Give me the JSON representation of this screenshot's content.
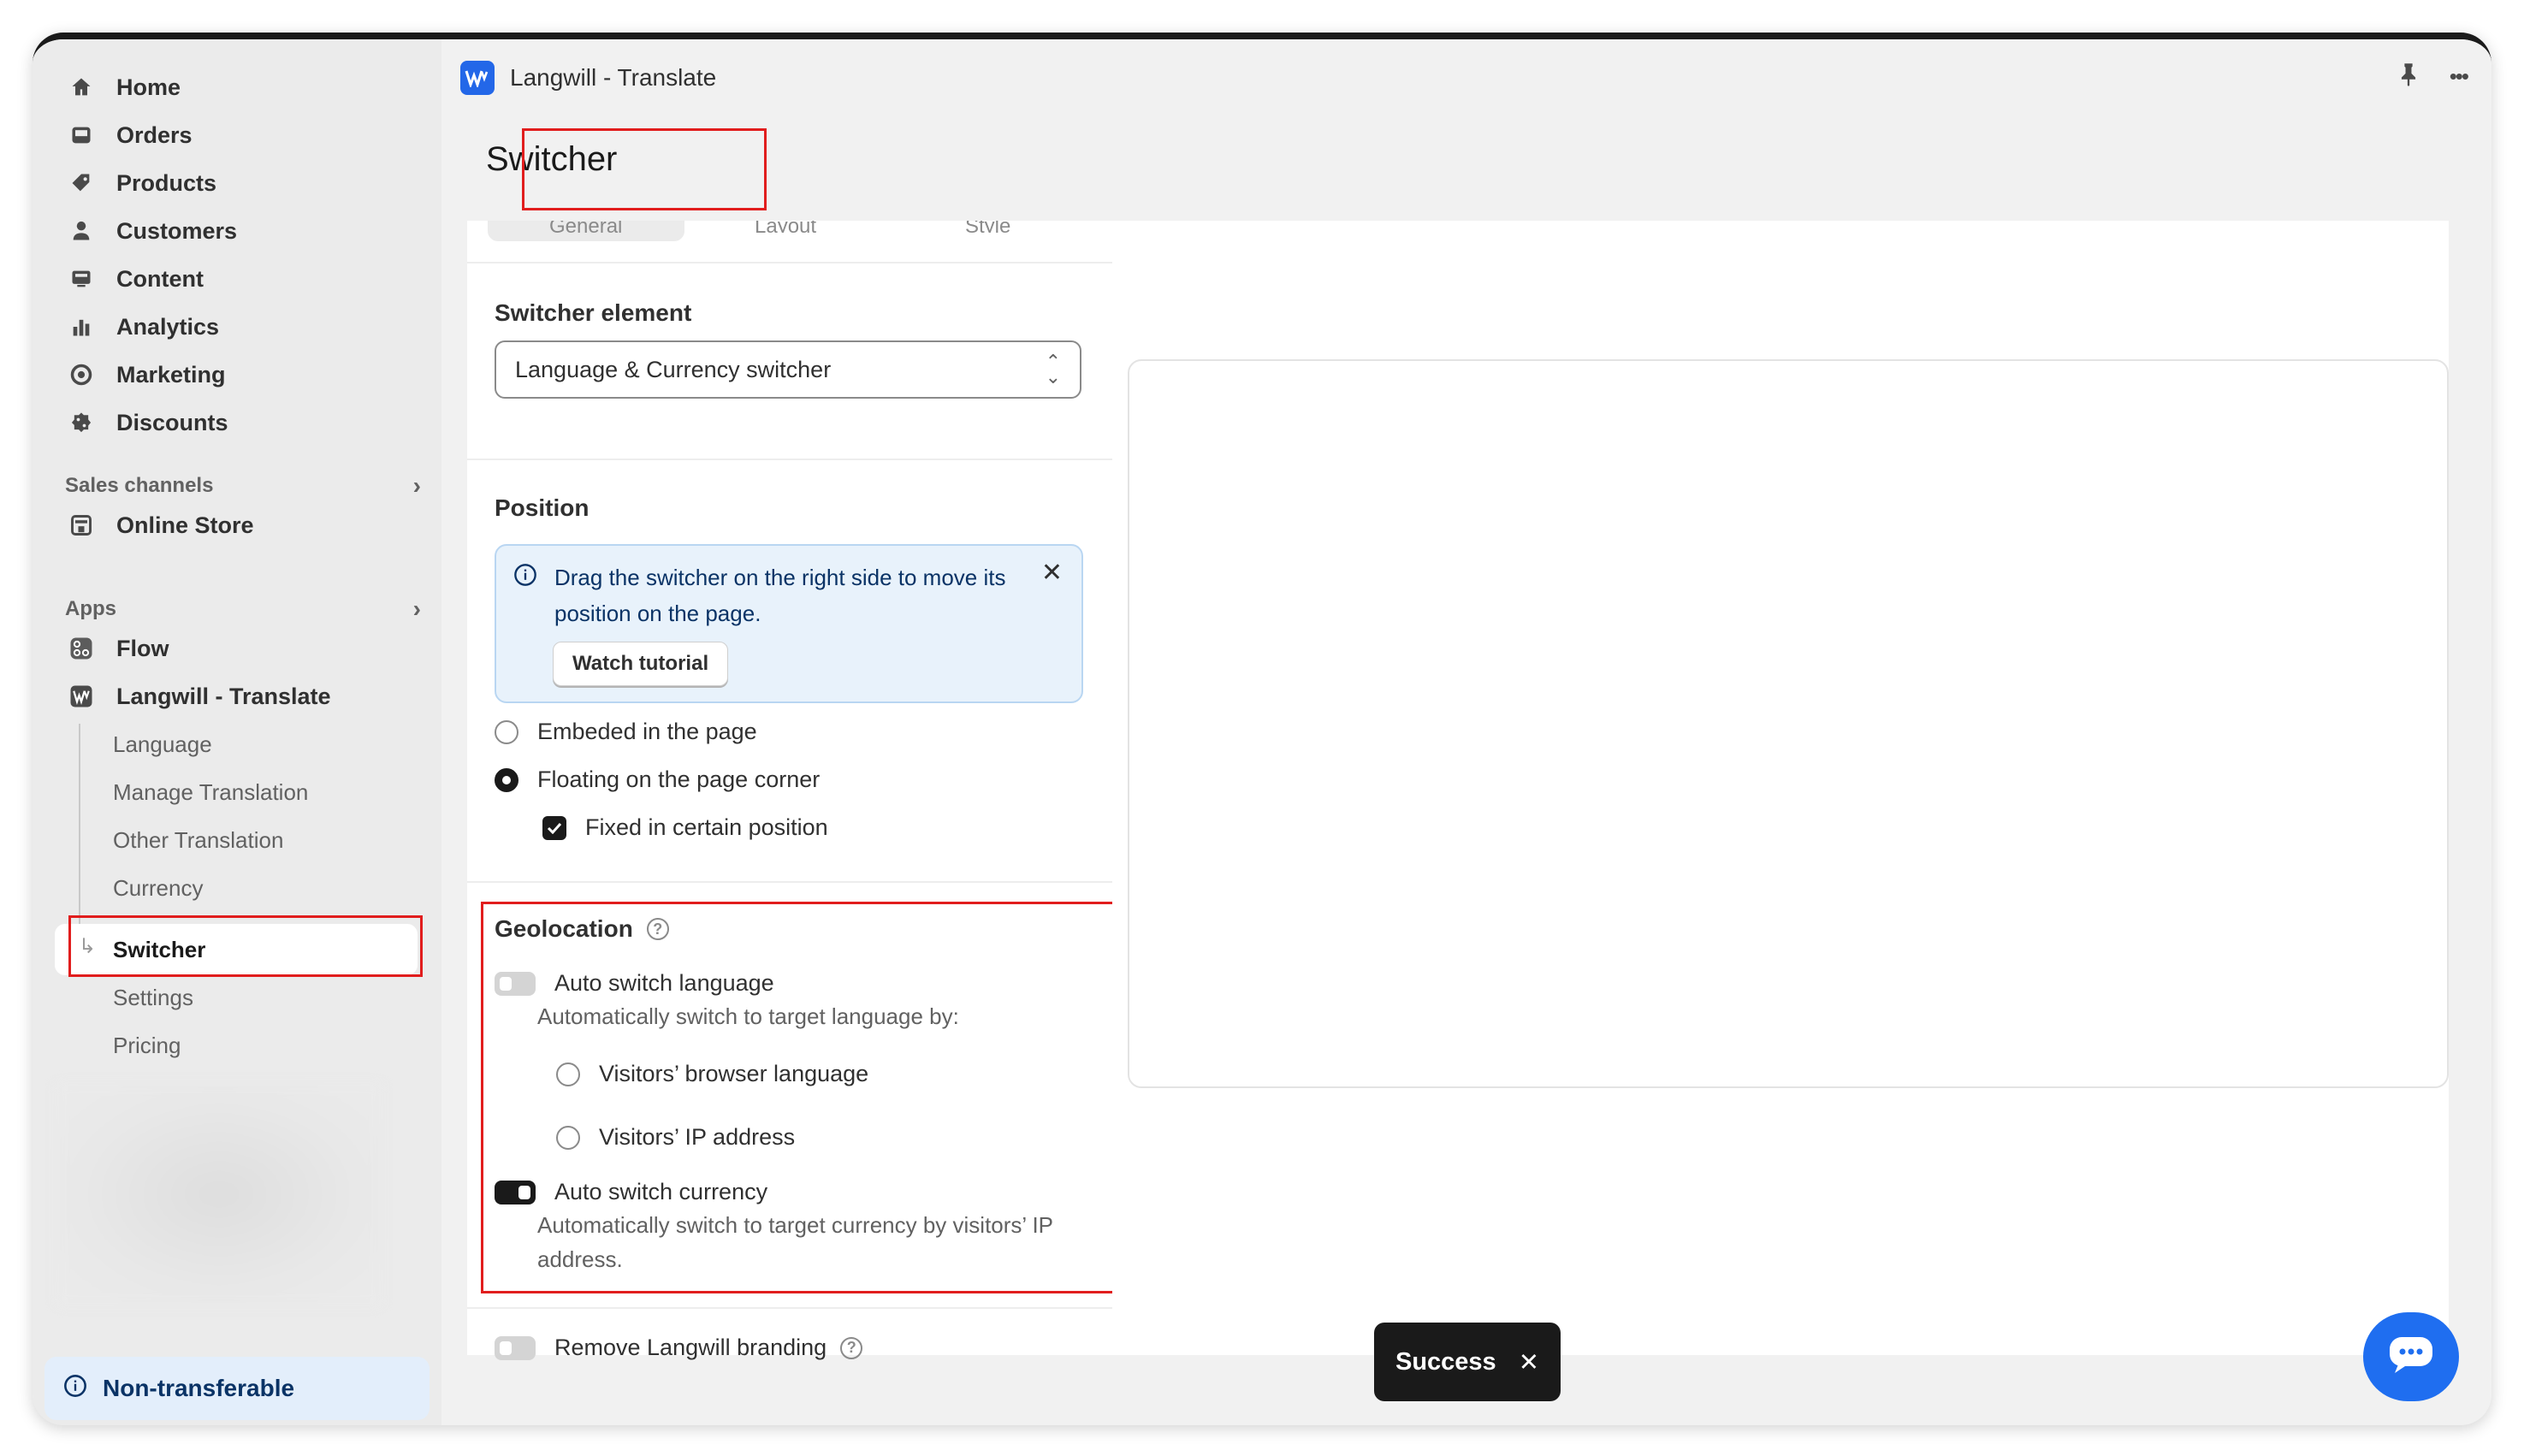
{
  "sidebar": {
    "items": [
      {
        "label": "Home",
        "icon": "home-icon"
      },
      {
        "label": "Orders",
        "icon": "inbox-icon"
      },
      {
        "label": "Products",
        "icon": "tag-icon"
      },
      {
        "label": "Customers",
        "icon": "person-icon"
      },
      {
        "label": "Content",
        "icon": "monitor-icon"
      },
      {
        "label": "Analytics",
        "icon": "bar-chart-icon"
      },
      {
        "label": "Marketing",
        "icon": "target-icon"
      },
      {
        "label": "Discounts",
        "icon": "discount-icon"
      }
    ],
    "sales_channels_label": "Sales channels",
    "online_store": "Online Store",
    "apps_label": "Apps",
    "flow": "Flow",
    "langwill": "Langwill - Translate",
    "sub_items": [
      "Language",
      "Manage Translation",
      "Other Translation",
      "Currency",
      "Switcher",
      "Settings",
      "Pricing"
    ],
    "non_transferable": "Non-transferable"
  },
  "topbar": {
    "app_title": "Langwill - Translate",
    "more": "•••"
  },
  "page": {
    "title": "Switcher"
  },
  "tabs": [
    "General",
    "Layout",
    "Style"
  ],
  "switcher_element": {
    "title": "Switcher element",
    "selected": "Language & Currency switcher"
  },
  "position": {
    "title": "Position",
    "banner_text": "Drag the switcher on the right side to move its position on the page.",
    "watch_tutorial": "Watch tutorial",
    "embedded": "Embeded in the page",
    "floating": "Floating on the page corner",
    "fixed": "Fixed in certain position"
  },
  "geolocation": {
    "title": "Geolocation",
    "auto_language": "Auto switch language",
    "auto_language_desc": "Automatically switch to target language by:",
    "browser_language": "Visitors’ browser language",
    "ip_address": "Visitors’ IP address",
    "auto_currency": "Auto switch currency",
    "auto_currency_desc": "Automatically switch to target currency by visitors’ IP address."
  },
  "branding": {
    "remove": "Remove Langwill branding"
  },
  "toast": {
    "message": "Success"
  },
  "colors": {
    "accent": "#2367e8",
    "highlight": "#e11d1d",
    "chat": "#1f6ef0"
  }
}
